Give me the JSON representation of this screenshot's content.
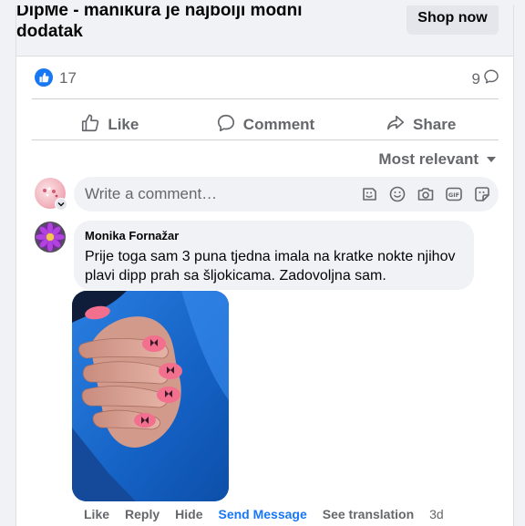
{
  "link_preview": {
    "title": "DipMe - manikura je najbolji modni dodatak",
    "cta_label": "Shop now"
  },
  "summary": {
    "reaction_count": "17",
    "comment_count": "9"
  },
  "actions": {
    "like": "Like",
    "comment": "Comment",
    "share": "Share"
  },
  "sort": {
    "label": "Most relevant"
  },
  "composer": {
    "placeholder": "Write a comment…",
    "icons": [
      "sticker-icon",
      "emoji-icon",
      "camera-icon",
      "gif-icon",
      "avatar-sticker-icon"
    ]
  },
  "comment": {
    "author": "Monika Fornažar",
    "text": "Prije toga sam 3 puna tjedna imala na kratke nokte njihov plavi dipp prah sa šljokicama. Zadovoljna sam.",
    "actions": {
      "like": "Like",
      "reply": "Reply",
      "hide": "Hide",
      "send_message": "Send Message",
      "see_translation": "See translation",
      "time": "3d"
    }
  },
  "colors": {
    "accent": "#1877f2",
    "secondary_text": "#65676b",
    "bubble_bg": "#f0f2f5",
    "nail_pink": "#f2708d"
  }
}
